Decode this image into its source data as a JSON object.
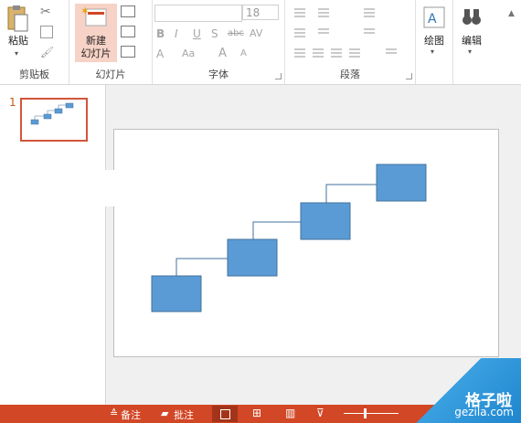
{
  "ribbon": {
    "clipboard": {
      "paste_label": "粘贴",
      "group_label": "剪贴板"
    },
    "slides": {
      "new_slide_label_1": "新建",
      "new_slide_label_2": "幻灯片",
      "group_label": "幻灯片"
    },
    "font": {
      "size_value": "18",
      "group_label": "字体",
      "bold": "B",
      "italic": "I",
      "underline": "U",
      "shadow": "S",
      "strike": "abc",
      "spacing": "AV",
      "font_color": "A",
      "aa": "Aa",
      "grow": "A",
      "shrink": "A"
    },
    "paragraph": {
      "group_label": "段落"
    },
    "drawing": {
      "label": "绘图"
    },
    "editing": {
      "label": "编辑"
    }
  },
  "thumbnails": {
    "slide_number": "1"
  },
  "status_bar": {
    "notes_label": "备注",
    "comments_label": "批注"
  },
  "watermark": {
    "line1": "格子啦",
    "line2": "gezila.com"
  },
  "colors": {
    "accent": "#d24726",
    "shape_fill": "#5b9bd5",
    "shape_border": "#41719c"
  }
}
